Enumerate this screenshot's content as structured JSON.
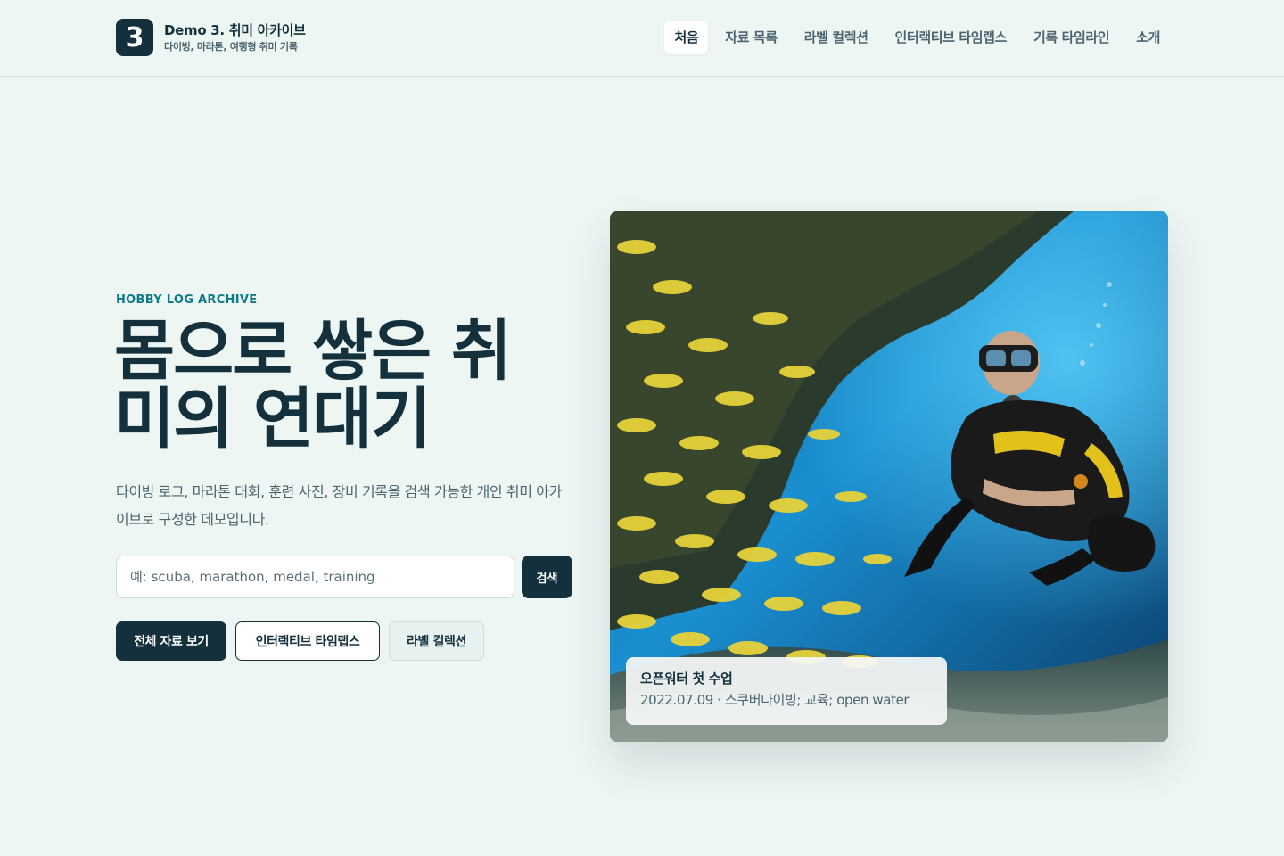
{
  "header": {
    "logo_number": "3",
    "title": "Demo 3. 취미 아카이브",
    "subtitle": "다이빙, 마라톤, 여행형 취미 기록",
    "nav": [
      {
        "label": "처음",
        "active": true
      },
      {
        "label": "자료 목록",
        "active": false
      },
      {
        "label": "라벨 컬렉션",
        "active": false
      },
      {
        "label": "인터랙티브 타임랩스",
        "active": false
      },
      {
        "label": "기록 타임라인",
        "active": false
      },
      {
        "label": "소개",
        "active": false
      }
    ]
  },
  "hero": {
    "eyebrow": "HOBBY LOG ARCHIVE",
    "title": "몸으로 쌓은 취미의 연대기",
    "description": "다이빙 로그, 마라톤 대회, 훈련 사진, 장비 기록을 검색 가능한 개인 취미 아카이브로 구성한 데모입니다.",
    "search": {
      "placeholder": "예: scuba, marathon, medal, training",
      "value": "",
      "button_label": "검색"
    },
    "actions": {
      "all_label": "전체 자료 보기",
      "timelapse_label": "인터랙티브 타임랩스",
      "labels_label": "라벨 컬렉션"
    }
  },
  "featured": {
    "image_icon": "scuba-diver-photo",
    "caption_title": "오픈워터 첫 수업",
    "caption_meta": "2022.07.09 · 스쿠버다이빙; 교육; open water"
  },
  "colors": {
    "background": "#eef6f4",
    "primary": "#13303c",
    "accent": "#0e7c86",
    "muted": "#4b6470"
  }
}
